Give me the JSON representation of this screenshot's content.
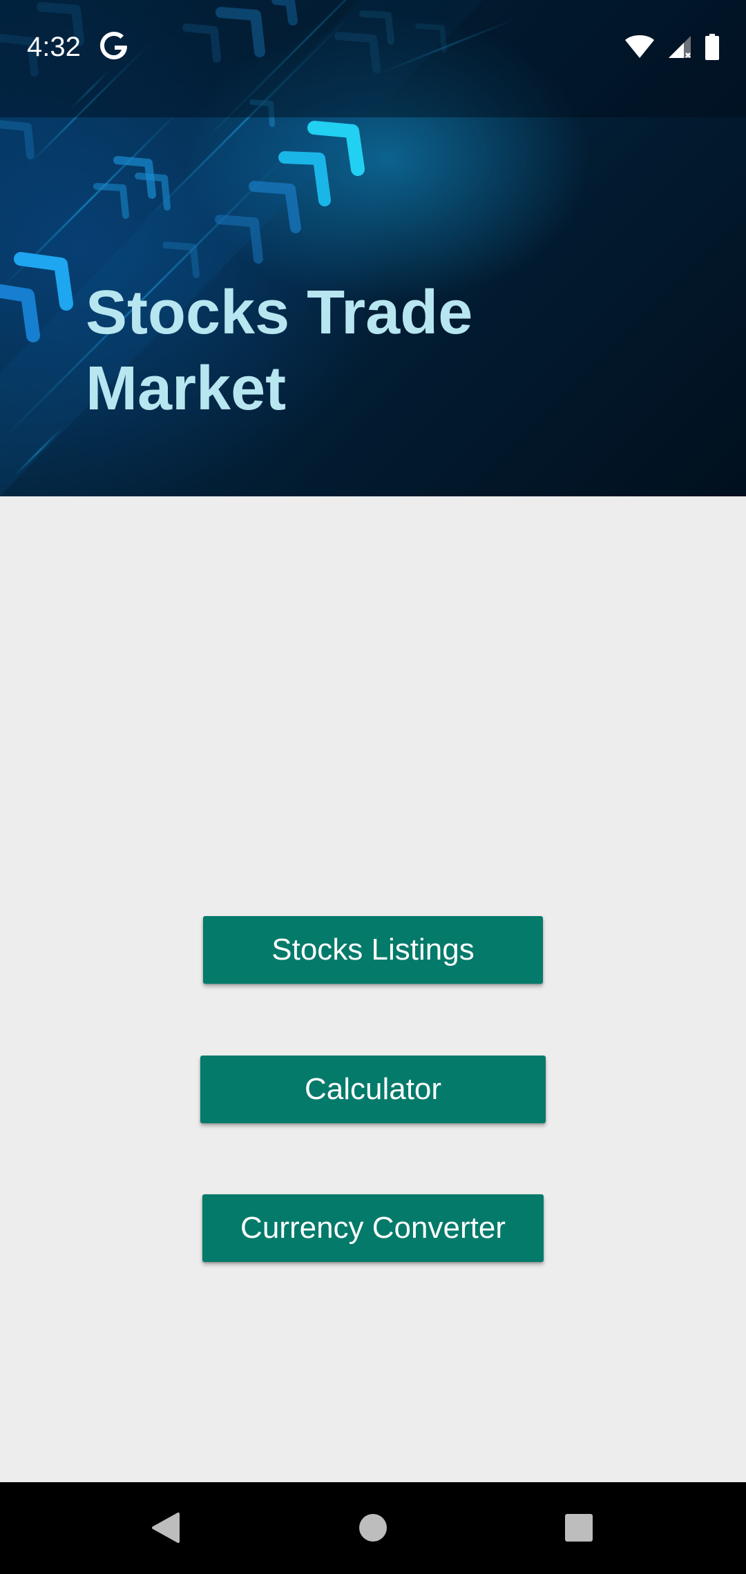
{
  "status_bar": {
    "time": "4:32",
    "icons": [
      "google-g-icon",
      "wifi-icon",
      "cellular-signal-icon",
      "battery-icon"
    ]
  },
  "hero": {
    "title_line1": "Stocks Trade",
    "title_line2": "Market",
    "title_color": "#b7e6f0",
    "background_colors": [
      "#03355c",
      "#01101e"
    ],
    "arrow_accent_color": "#1ec8f0"
  },
  "menu": {
    "buttons": [
      {
        "label": "Stocks Listings"
      },
      {
        "label": "Calculator"
      },
      {
        "label": "Currency Converter"
      }
    ],
    "button_color": "#047a6a",
    "button_text_color": "#ffffff"
  },
  "navigation_bar": {
    "buttons": [
      "back-icon",
      "home-icon",
      "recents-icon"
    ]
  },
  "page_background": "#ededed"
}
